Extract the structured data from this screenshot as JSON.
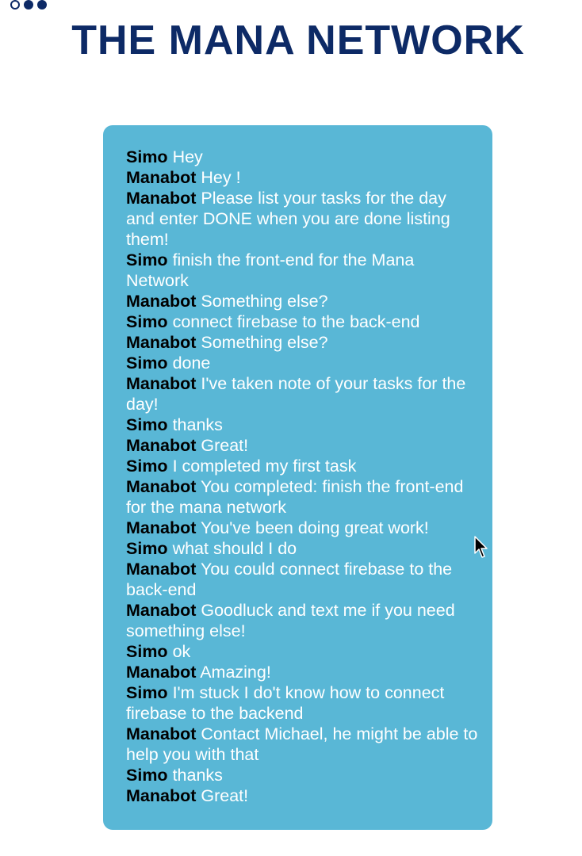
{
  "header": {
    "title": "THE MANA NETWORK",
    "logo_icon": "three-dots-logo-icon",
    "brand_color": "#0d2a66"
  },
  "chat": {
    "panel_color": "#59b7d6",
    "messages": [
      {
        "speaker": "Simo",
        "text": "Hey"
      },
      {
        "speaker": "Manabot",
        "text": "Hey !"
      },
      {
        "speaker": "Manabot",
        "text": "Please list your tasks for the day and enter DONE when you are done listing them!"
      },
      {
        "speaker": "Simo",
        "text": "finish the front-end for the Mana Network"
      },
      {
        "speaker": "Manabot",
        "text": "Something else?"
      },
      {
        "speaker": "Simo",
        "text": "connect firebase to the back-end"
      },
      {
        "speaker": "Manabot",
        "text": "Something else?"
      },
      {
        "speaker": "Simo",
        "text": "done"
      },
      {
        "speaker": "Manabot",
        "text": "I've taken note of your tasks for the day!"
      },
      {
        "speaker": "Simo",
        "text": "thanks"
      },
      {
        "speaker": "Manabot",
        "text": "Great!"
      },
      {
        "speaker": "Simo",
        "text": "I completed my first task"
      },
      {
        "speaker": "Manabot",
        "text": "You completed: finish the front-end for the mana network"
      },
      {
        "speaker": "Manabot",
        "text": "You've been doing great work!"
      },
      {
        "speaker": "Simo",
        "text": "what should I do"
      },
      {
        "speaker": "Manabot",
        "text": "You could connect firebase to the back-end"
      },
      {
        "speaker": "Manabot",
        "text": "Goodluck and text me if you need something else!"
      },
      {
        "speaker": "Simo",
        "text": "ok"
      },
      {
        "speaker": "Manabot",
        "text": "Amazing!"
      },
      {
        "speaker": "Simo",
        "text": "I'm stuck I do't know how to connect firebase to the backend"
      },
      {
        "speaker": "Manabot",
        "text": "Contact Michael, he might be able to help you with that"
      },
      {
        "speaker": "Simo",
        "text": "thanks"
      },
      {
        "speaker": "Manabot",
        "text": "Great!"
      }
    ]
  },
  "cursor_icon": "mouse-pointer-icon"
}
